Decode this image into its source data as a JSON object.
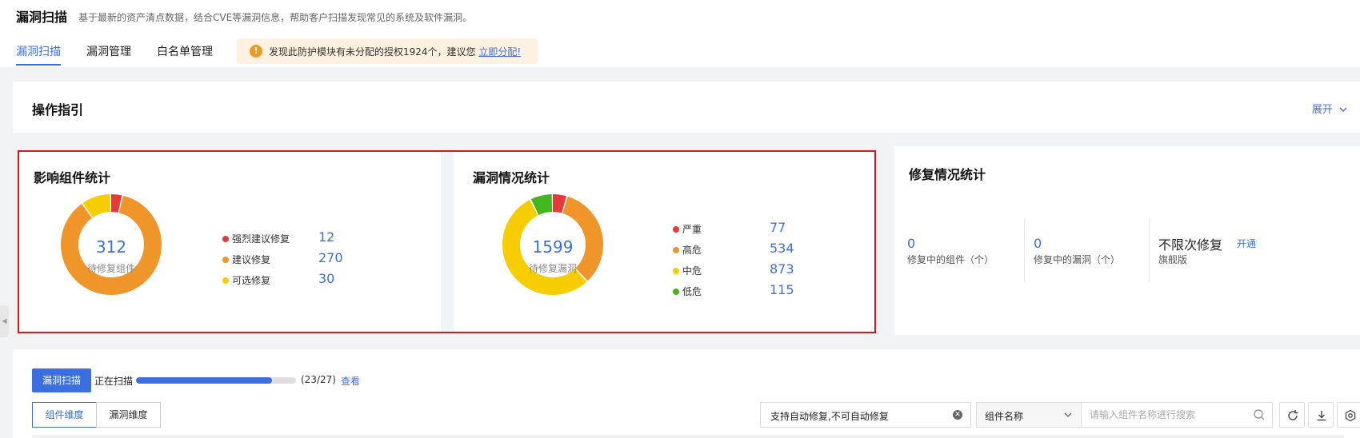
{
  "header": {
    "title": "漏洞扫描",
    "description": "基于最新的资产清点数据，结合CVE等漏洞信息，帮助客户扫描发现常见的系统及软件漏洞。",
    "tabs": [
      {
        "label": "漏洞扫描",
        "active": true
      },
      {
        "label": "漏洞管理",
        "active": false
      },
      {
        "label": "白名单管理",
        "active": false
      }
    ],
    "notice": {
      "icon": "exclamation-icon",
      "text": "发现此防护模块有未分配的授权1924个，建议您",
      "link": "立即分配!"
    }
  },
  "guide": {
    "title": "操作指引",
    "expand_label": "展开"
  },
  "component_stats": {
    "title": "影响组件统计",
    "total": "312",
    "total_label": "待修复组件",
    "items": [
      {
        "label": "强烈建议修复",
        "value": "12",
        "color": "#e8393a"
      },
      {
        "label": "建议修复",
        "value": "270",
        "color": "#f0952a"
      },
      {
        "label": "可选修复",
        "value": "30",
        "color": "#f5cd00"
      }
    ]
  },
  "vuln_stats": {
    "title": "漏洞情况统计",
    "total": "1599",
    "total_label": "待修复漏洞",
    "items": [
      {
        "label": "严重",
        "value": "77",
        "color": "#e8393a"
      },
      {
        "label": "高危",
        "value": "534",
        "color": "#f0952a"
      },
      {
        "label": "中危",
        "value": "873",
        "color": "#f5cd00"
      },
      {
        "label": "低危",
        "value": "115",
        "color": "#43b51f"
      }
    ]
  },
  "fix_stats": {
    "title": "修复情况统计",
    "fixing_components": "0",
    "fixing_components_label": "修复中的组件（个）",
    "fixing_vulns": "0",
    "fixing_vulns_label": "修复中的漏洞（个）",
    "plan_title": "不限次修复",
    "plan_subtitle": "旗舰版",
    "plan_link": "开通"
  },
  "toolbar": {
    "scan_button": "漏洞扫描",
    "scanning_label": "正在扫描",
    "progress": 0.85,
    "progress_text": "(23/27)",
    "view_link": "查看",
    "dim_component": "组件维度",
    "dim_vuln": "漏洞维度",
    "filter_value": "支持自动修复,不可自动修复",
    "select_value": "组件名称",
    "search_placeholder": "请输入组件名称进行搜索"
  },
  "colors": {
    "accent": "#3b6fe0",
    "highlight_frame": "#d5161c"
  }
}
